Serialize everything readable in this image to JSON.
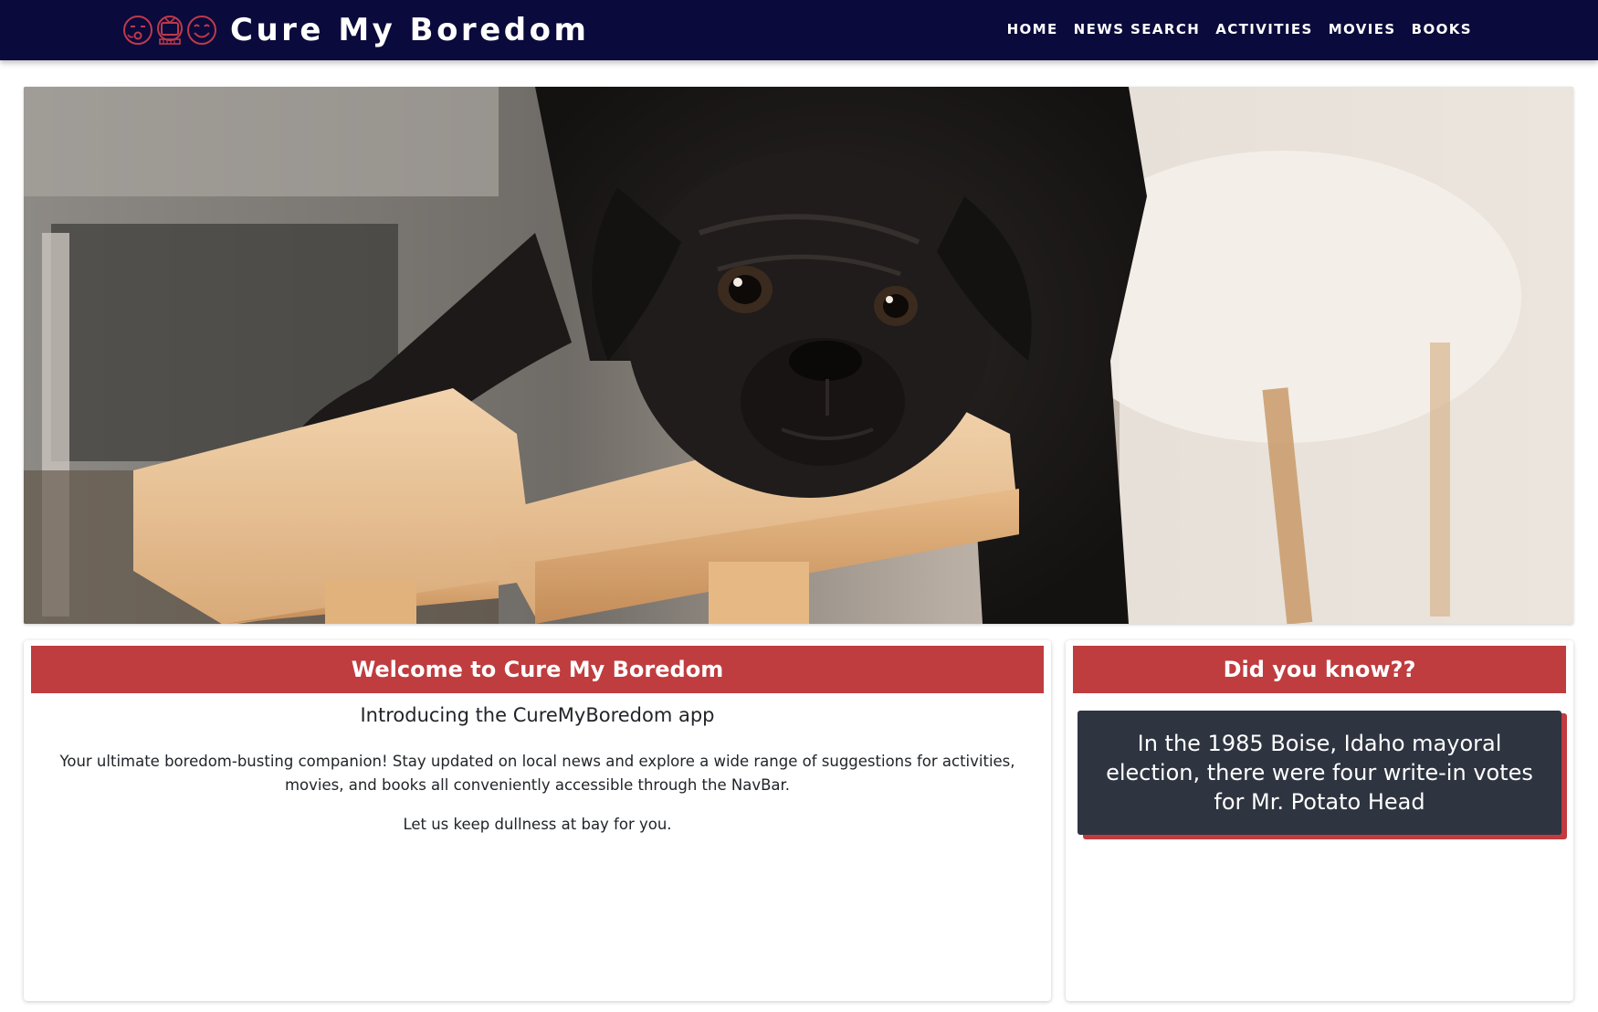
{
  "brand": {
    "title": "Cure My Boredom",
    "logo_icons": [
      "bored-face-icon",
      "tv-icon",
      "happy-face-icon"
    ]
  },
  "nav": {
    "items": [
      {
        "label": "Home"
      },
      {
        "label": "News Search"
      },
      {
        "label": "Activities"
      },
      {
        "label": "Movies"
      },
      {
        "label": "Books"
      }
    ]
  },
  "hero": {
    "image": "black pug resting its head on a wooden stool"
  },
  "welcome": {
    "heading": "Welcome to Cure My Boredom",
    "subheading": "Introducing the CureMyBoredom app",
    "body": "Your ultimate boredom-busting companion! Stay updated on local news and explore a wide range of suggestions for activities, movies, and books all conveniently accessible through the NavBar.",
    "tagline": "Let us keep dullness at bay for you."
  },
  "fact": {
    "heading": "Did you know??",
    "text": "In the 1985 Boise, Idaho mayoral election, there were four write-in votes for Mr. Potato Head"
  },
  "colors": {
    "navbar_bg": "#0a0a3c",
    "accent_red": "#bf3c3f",
    "fact_box_bg": "#2e3440",
    "logo_red": "#c0394b"
  }
}
